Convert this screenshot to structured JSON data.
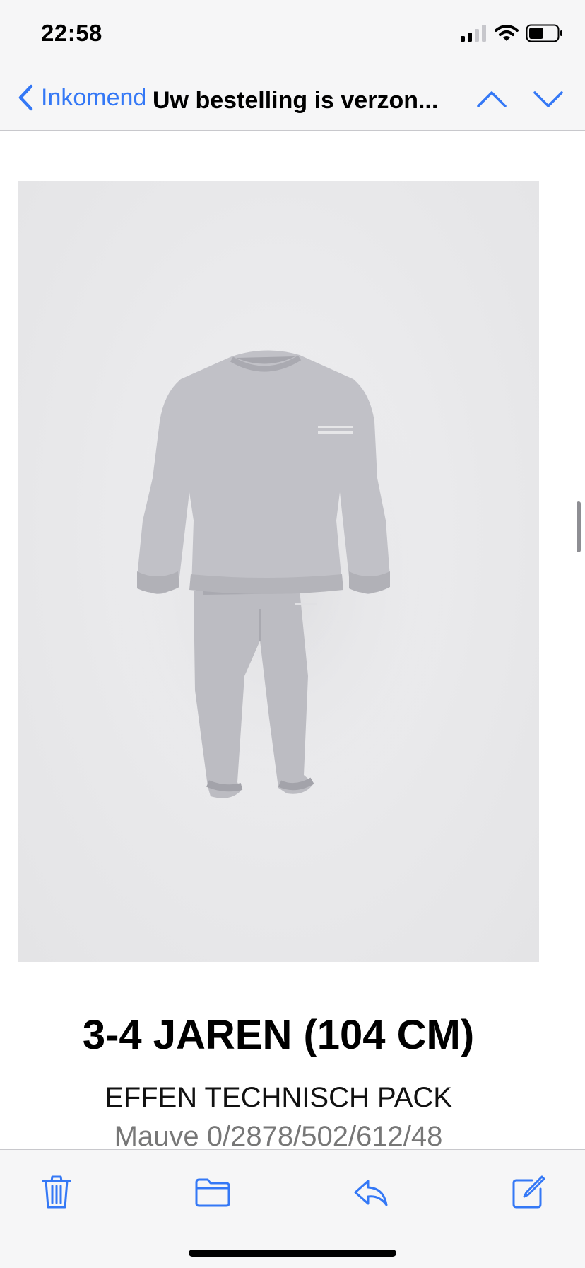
{
  "status_bar": {
    "time": "22:58",
    "battery_level": 0.5,
    "signal_bars": 2
  },
  "nav": {
    "back_label": "Inkomend",
    "subject": "Uw bestelling is verzon..."
  },
  "product": {
    "size": "3-4 JAREN (104 CM)",
    "name": "EFFEN TECHNISCH PACK",
    "reference": "Mauve 0/2878/502/612/48"
  },
  "colors": {
    "accent": "#3478f6",
    "bar_background": "#f6f6f7",
    "garment": "#bdbdc3"
  },
  "icons": {
    "back": "chevron-left-icon",
    "prev": "chevron-up-icon",
    "next": "chevron-down-icon",
    "trash": "trash-icon",
    "folder": "folder-icon",
    "reply": "reply-icon",
    "compose": "compose-icon"
  }
}
